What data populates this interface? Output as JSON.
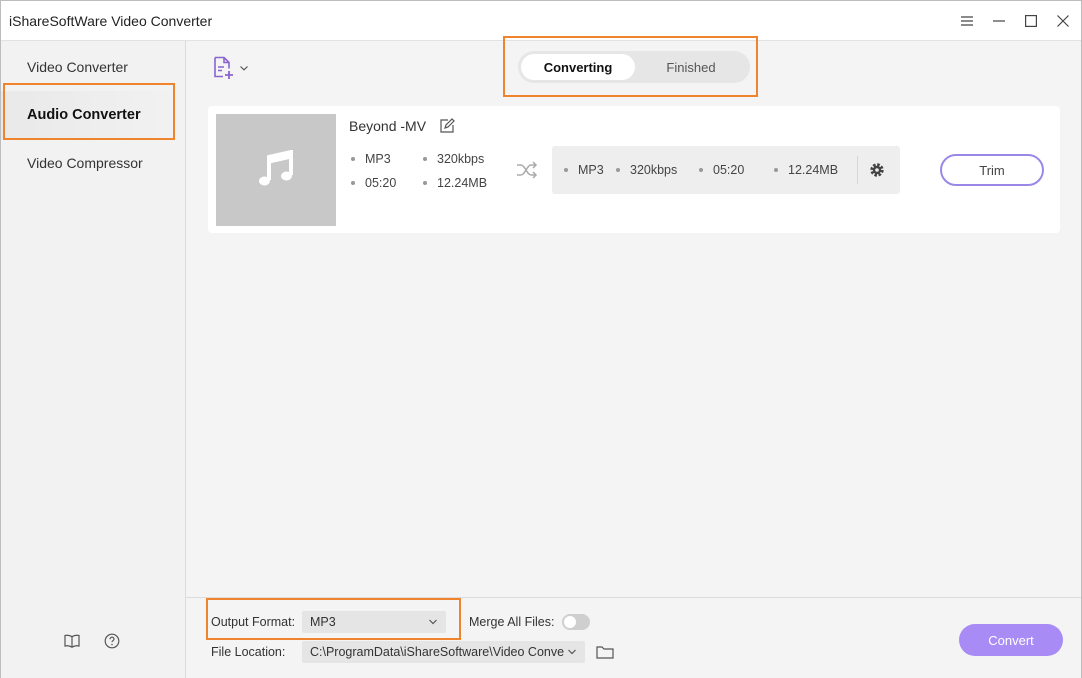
{
  "app": {
    "title": "iShareSoftWare Video Converter"
  },
  "window_controls": [
    "menu-icon",
    "minimize-icon",
    "maximize-icon",
    "close-icon"
  ],
  "sidebar": {
    "items": [
      {
        "label": "Video Converter",
        "active": false
      },
      {
        "label": "Audio Converter",
        "active": true
      },
      {
        "label": "Video Compressor",
        "active": false
      }
    ],
    "footer_icons": [
      "book-icon",
      "help-icon"
    ]
  },
  "tabs": {
    "converting": "Converting",
    "finished": "Finished",
    "active": "Converting"
  },
  "file": {
    "name": "Beyond -MV",
    "source": {
      "format": "MP3",
      "bitrate": "320kbps",
      "duration": "05:20",
      "size": "12.24MB"
    },
    "output": {
      "format": "MP3",
      "bitrate": "320kbps",
      "duration": "05:20",
      "size": "12.24MB"
    },
    "trim_label": "Trim"
  },
  "footer": {
    "output_format_label": "Output Format:",
    "output_format_value": "MP3",
    "merge_label": "Merge All Files:",
    "merge_enabled": false,
    "file_location_label": "File Location:",
    "file_location_value": "C:\\ProgramData\\iShareSoftware\\Video Conve",
    "convert_label": "Convert"
  },
  "colors": {
    "accent": "#a88bf5",
    "accent_border": "#9b87e8",
    "highlight": "#f0842c",
    "icon_purple": "#8a63d2"
  }
}
